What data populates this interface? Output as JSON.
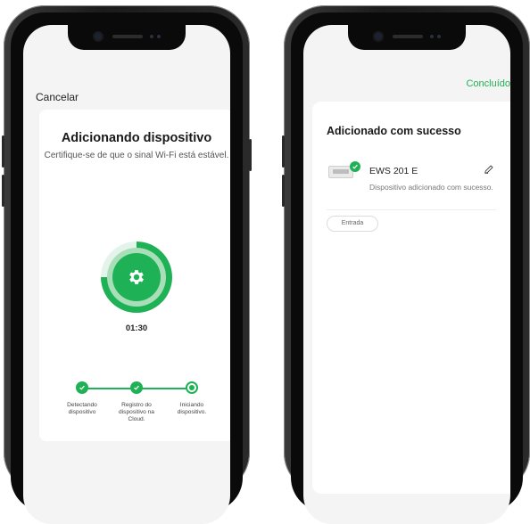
{
  "left_screen": {
    "cancel_label": "Cancelar",
    "title": "Adicionando dispositivo",
    "subtitle": "Certifique-se de que o sinal Wi-Fi está estável.",
    "timer": "01:30",
    "progress_fraction": 0.75,
    "steps": [
      {
        "label": "Detectando dispositivo",
        "state": "done"
      },
      {
        "label": "Registro do dispositivo na Cloud.",
        "state": "done"
      },
      {
        "label": "Iniciando dispositivo.",
        "state": "in-progress"
      }
    ],
    "center_icon": "gear-icon"
  },
  "right_screen": {
    "done_label": "Concluído",
    "title": "Adicionado com sucesso",
    "device": {
      "name": "EWS 201 E",
      "status": "Dispositivo adicionado com sucesso.",
      "badge_icon": "check-icon",
      "edit_icon": "pencil-icon"
    },
    "room_chip": "Entrada"
  },
  "colors": {
    "accent": "#1fb155",
    "ring_light": "#a8dfb9",
    "background": "#f4f4f4"
  }
}
